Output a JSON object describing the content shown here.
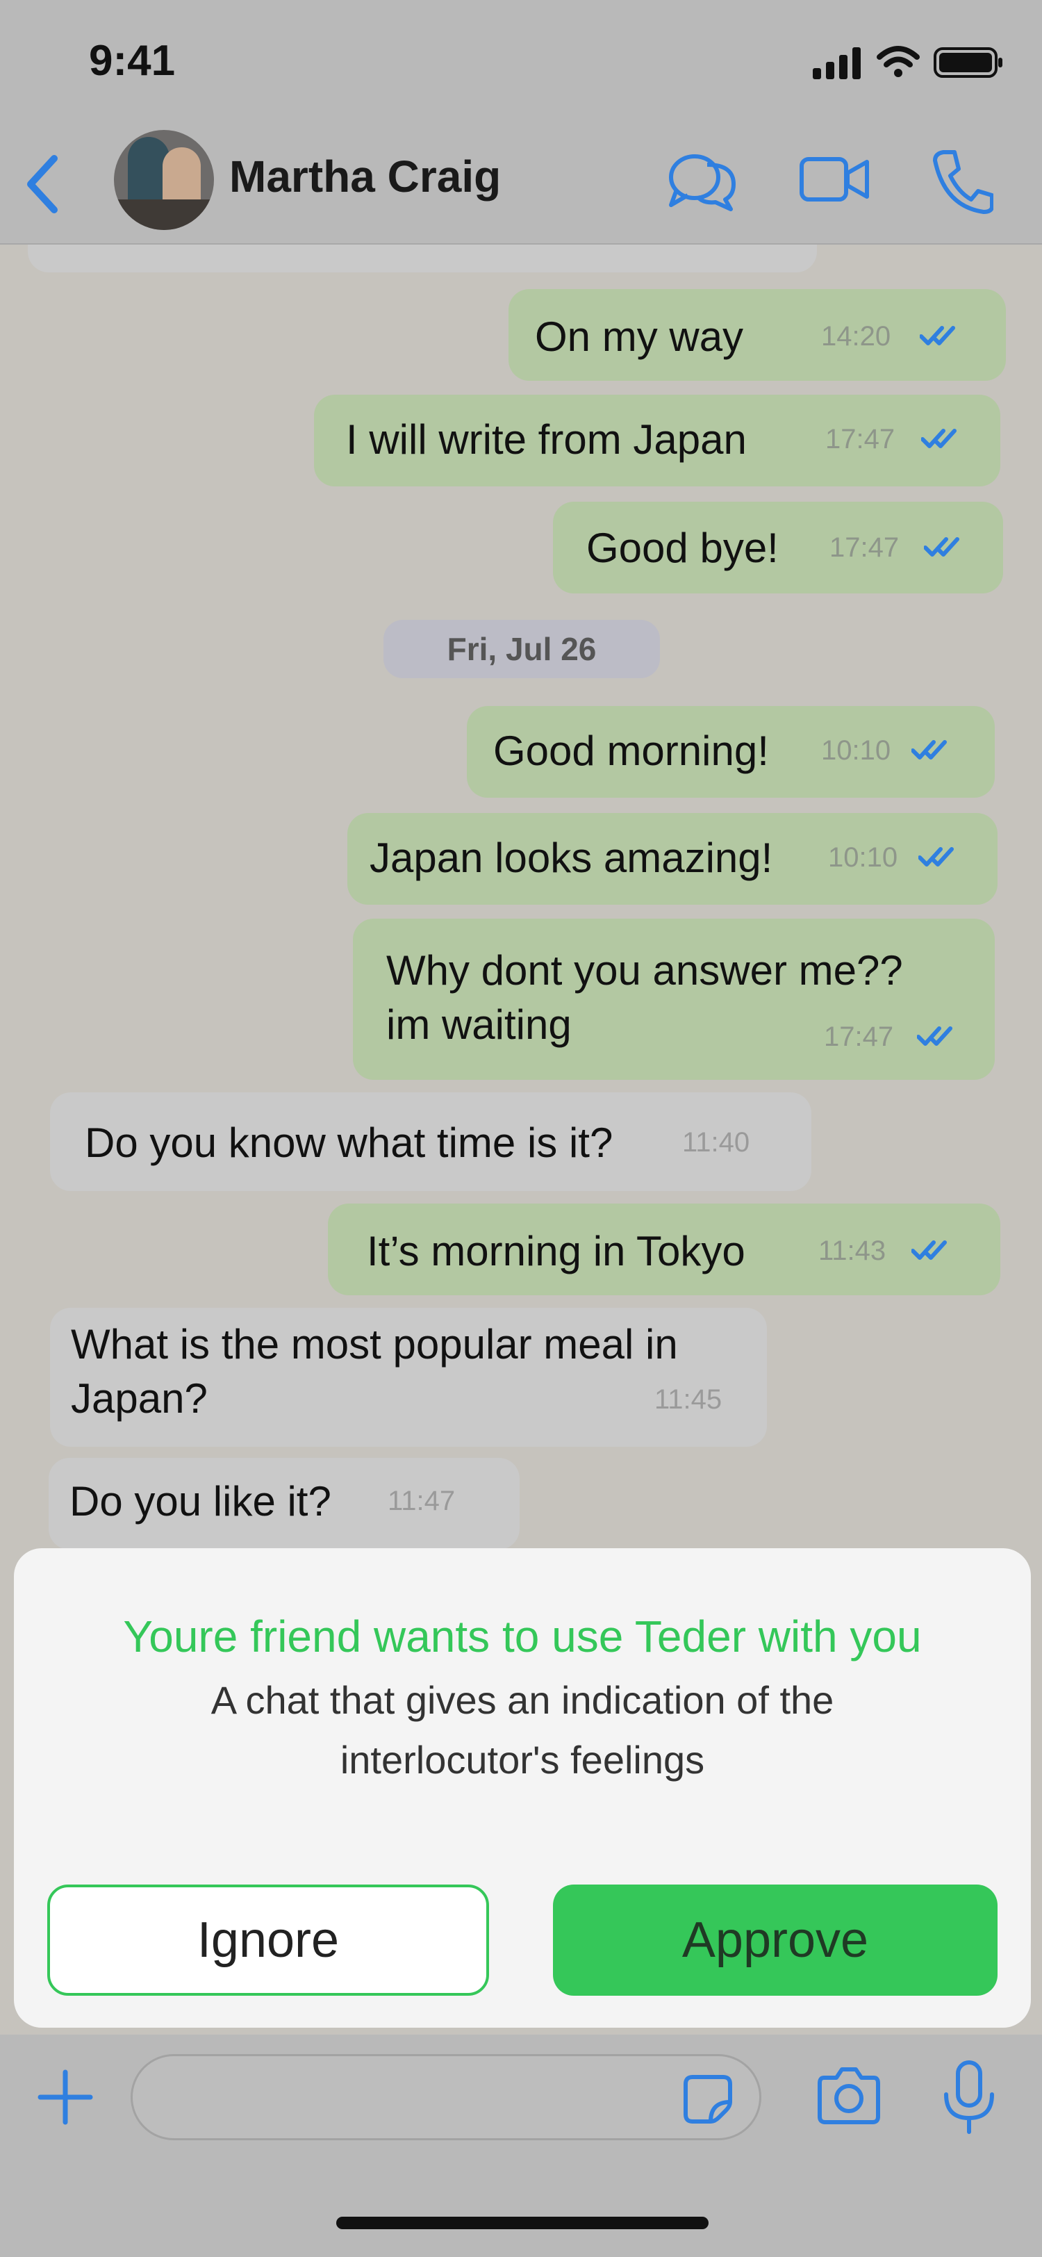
{
  "status_bar": {
    "time": "9:41"
  },
  "header": {
    "contact_name": "Martha Craig"
  },
  "date_chip": "Fri, Jul 26",
  "messages": [
    {
      "text": "On my way",
      "time": "14:20"
    },
    {
      "text": "I will write from Japan",
      "time": "17:47"
    },
    {
      "text": "Good bye!",
      "time": "17:47"
    },
    {
      "text": "Good morning!",
      "time": "10:10"
    },
    {
      "text": "Japan looks amazing!",
      "time": "10:10"
    },
    {
      "line1": "Why dont you answer me??",
      "line2": "im waiting",
      "time": "17:47"
    },
    {
      "text": "Do you know what time is it?",
      "time": "11:40"
    },
    {
      "text": "It’s morning in Tokyo",
      "time": "11:43"
    },
    {
      "line1": "What is the most popular meal in",
      "line2": "Japan?",
      "time": "11:45"
    },
    {
      "text": "Do you like it?",
      "time": "11:47"
    }
  ],
  "modal": {
    "title": "Youre friend wants to use Teder with you",
    "line1": "A chat that gives an indication of the",
    "line2": "interlocutor's feelings",
    "ignore_label": "Ignore",
    "approve_label": "Approve"
  },
  "colors": {
    "accent_blue": "#2f7fe0",
    "approve_green": "#35c759",
    "title_green": "#34c759",
    "outgoing_bubble": "#b3c8a2",
    "incoming_bubble": "#c9c9c9"
  },
  "icons": [
    "back-chevron-icon",
    "chat-bubbles-icon",
    "video-call-icon",
    "phone-icon",
    "plus-icon",
    "sticker-icon",
    "camera-icon",
    "microphone-icon",
    "double-check-icon"
  ]
}
